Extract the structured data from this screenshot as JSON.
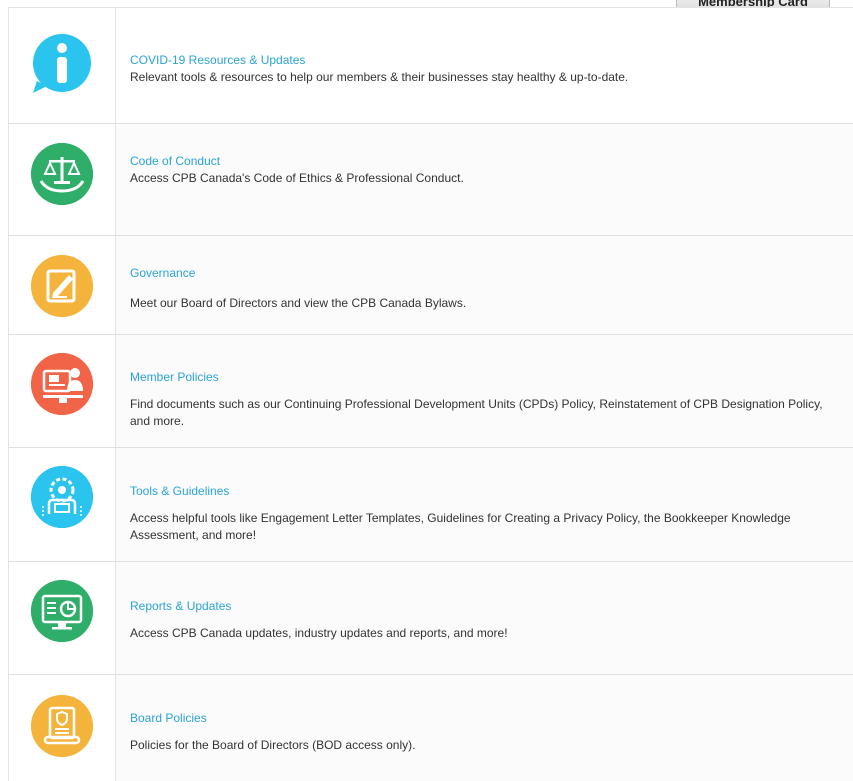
{
  "membership_button": "Membership Card",
  "rows": [
    {
      "title": "COVID-19 Resources & Updates",
      "description": "Relevant tools & resources to help our members & their businesses stay healthy & up-to-date.",
      "icon": "info-bubble-icon",
      "color": "#2bc4ee"
    },
    {
      "title": "Code of Conduct",
      "description": "Access CPB Canada's Code of Ethics & Professional Conduct.",
      "icon": "scales-icon",
      "color": "#2fae6a"
    },
    {
      "title": "Governance",
      "description": "Meet our Board of Directors and view the CPB Canada Bylaws.",
      "icon": "document-edit-icon",
      "color": "#f4b43c"
    },
    {
      "title": "Member Policies",
      "description": "Find documents such as our Continuing Professional Development Units (CPDs) Policy, Reinstatement of CPB Designation Policy, and more.",
      "icon": "presentation-icon",
      "color": "#f26447"
    },
    {
      "title": "Tools & Guidelines",
      "description": "Access helpful tools like Engagement Letter Templates, Guidelines for Creating a Privacy Policy, the Bookkeeper Knowledge Assessment, and more!",
      "icon": "gear-head-icon",
      "color": "#2bc4ee"
    },
    {
      "title": "Reports & Updates",
      "description": "Access CPB Canada updates, industry updates and reports, and more!",
      "icon": "monitor-chart-icon",
      "color": "#2fae6a"
    },
    {
      "title": "Board Policies",
      "description": "Policies for the Board of Directors (BOD access only).",
      "icon": "scroll-icon",
      "color": "#f4b43c"
    }
  ]
}
